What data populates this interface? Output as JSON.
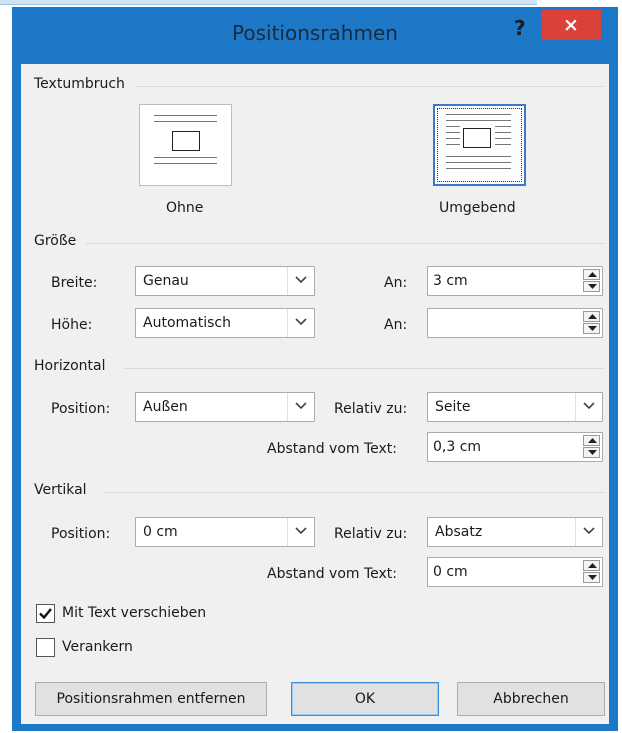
{
  "dialog": {
    "title": "Positionsrahmen",
    "help_label": "?",
    "close_label": "×"
  },
  "wrap": {
    "group_label": "Textumbruch",
    "options": [
      {
        "label": "Ohne",
        "selected": false
      },
      {
        "label": "Umgebend",
        "selected": true
      }
    ]
  },
  "size": {
    "group_label": "Größe",
    "width_label": "Breite:",
    "width_value": "Genau",
    "height_label": "Höhe:",
    "height_value": "Automatisch",
    "at_label": "An:",
    "width_at_value": "3 cm",
    "height_at_value": ""
  },
  "horizontal": {
    "group_label": "Horizontal",
    "position_label": "Position:",
    "position_value": "Außen",
    "relative_label": "Relativ zu:",
    "relative_value": "Seite",
    "distance_label": "Abstand vom Text:",
    "distance_value": "0,3 cm"
  },
  "vertical": {
    "group_label": "Vertikal",
    "position_label": "Position:",
    "position_value": "0 cm",
    "relative_label": "Relativ zu:",
    "relative_value": "Absatz",
    "distance_label": "Abstand vom Text:",
    "distance_value": "0 cm"
  },
  "options": {
    "move_with_text": {
      "label": "Mit Text verschieben",
      "checked": true
    },
    "lock_anchor": {
      "label": "Verankern",
      "checked": false
    }
  },
  "buttons": {
    "remove": "Positionsrahmen entfernen",
    "ok": "OK",
    "cancel": "Abbrechen"
  },
  "colors": {
    "title_bar": "#1e78c8",
    "close_button": "#d9413a",
    "client_bg": "#f0f0f0",
    "selection_border": "#3d78c2"
  }
}
